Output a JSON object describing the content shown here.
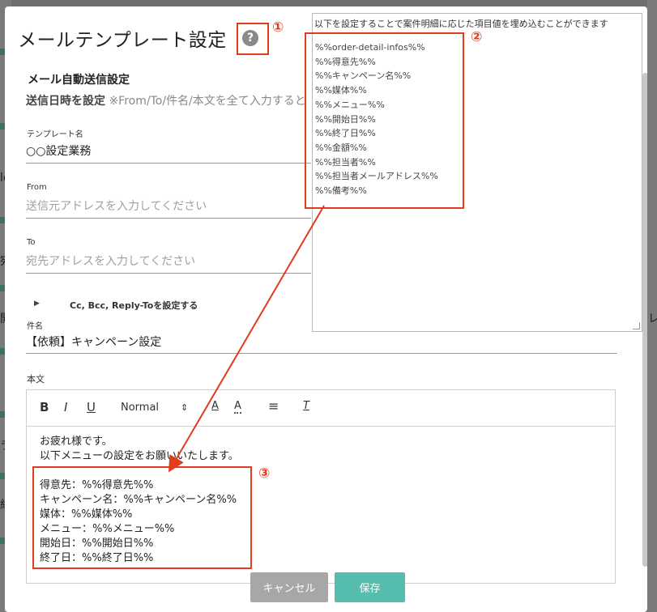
{
  "dialog": {
    "title": "メールテンプレート設定",
    "help_icon": "?"
  },
  "annotations": {
    "n1": "①",
    "n2": "②",
    "n3": "③"
  },
  "section": {
    "title": "メール自動送信設定",
    "desc_strong": "送信日時を設定",
    "desc_rest": " ※From/To/件名/本文を全て入力すると"
  },
  "fields": {
    "template_name": {
      "label": "テンプレート名",
      "value": "○○設定業務"
    },
    "from": {
      "label": "From",
      "placeholder": "送信元アドレスを入力してください"
    },
    "to": {
      "label": "To",
      "placeholder": "宛先アドレスを入力してください"
    },
    "cc_toggle": "Cc, Bcc, Reply-Toを設定する",
    "subject": {
      "label": "件名",
      "value": "【依頼】キャンペーン設定"
    },
    "body": {
      "label": "本文"
    }
  },
  "toolbar": {
    "bold": "B",
    "italic": "I",
    "underline": "U",
    "format": "Normal",
    "format_arrows": "⇕",
    "text_color": "A",
    "background": "A",
    "align": "≡",
    "clear": "T"
  },
  "body_lines": [
    "お疲れ様です。",
    "以下メニューの設定をお願いいたします。",
    "",
    "得意先：%%得意先%%",
    "キャンペーン名：%%キャンペーン名%%",
    "媒体：%%媒体%%",
    "メニュー：%%メニュー%%",
    "開始日：%%開始日%%",
    "終了日：%%終了日%%"
  ],
  "var_panel": {
    "hint": "以下を設定することで案件明細に応じた項目値を埋め込むことができます",
    "variables": [
      "%%order-detail-infos%%",
      "%%得意先%%",
      "%%キャンペーン名%%",
      "%%媒体%%",
      "%%メニュー%%",
      "%%開始日%%",
      "%%終了日%%",
      "%%金額%%",
      "%%担当者%%",
      "%%担当者メールアドレス%%",
      "%%備考%%"
    ]
  },
  "buttons": {
    "cancel": "キャンセル",
    "save": "保存"
  },
  "background_chars": {
    "l1": "ld",
    "l2": "宛",
    "l3": "開",
    "l4": "ラ",
    "l5": "終",
    "r1": "レ"
  },
  "colors": {
    "accent_red": "#e23b1e",
    "save_teal": "#56bcae",
    "cancel_gray": "#a7a7a7"
  }
}
